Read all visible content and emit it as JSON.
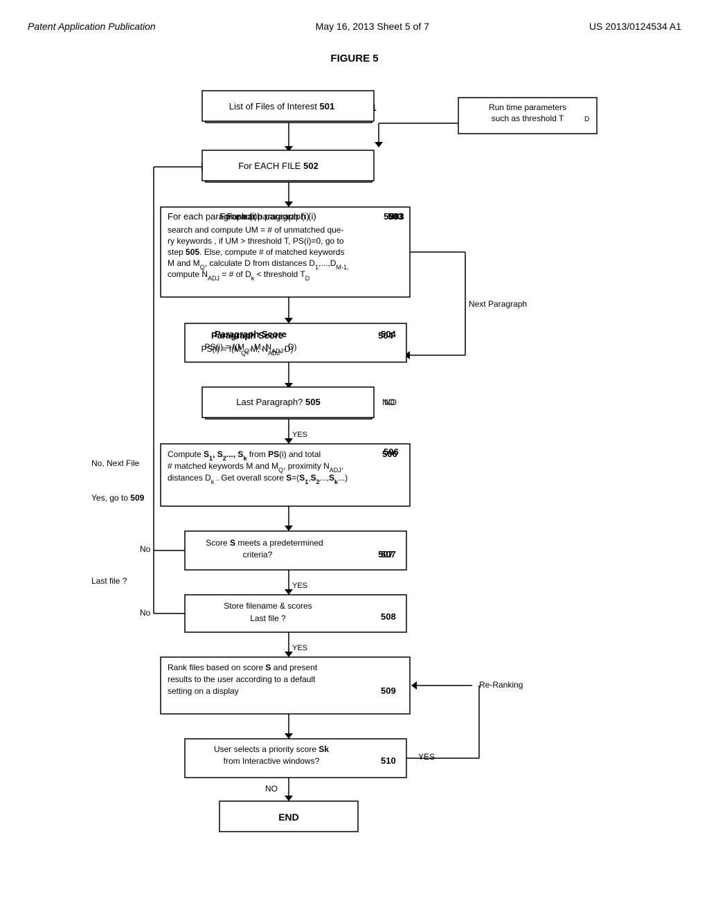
{
  "header": {
    "left": "Patent Application Publication",
    "center": "May 16, 2013   Sheet 5 of 7",
    "right": "US 2013/0124534 A1"
  },
  "figure": {
    "title": "FIGURE 5"
  },
  "boxes": {
    "box501": {
      "label": "List of Files of Interest",
      "num": "501"
    },
    "box502": {
      "label": "For EACH FILE",
      "num": "502"
    },
    "box_runtime": {
      "text": "Run time parameters\nsuch as threshold T",
      "subscript": "D"
    },
    "box503": {
      "label": "For each paragraph (i)",
      "num": "503",
      "detail": "search and compute UM = # of unmatched query keywords , if UM > threshold T, PS(i)=0, go to step 505. Else, compute # of matched keywords M and Mᴊ, calculate D from distances D₁,...,Dₘ₋₁, compute Nₐₑⰼ = # of Dₖ < threshold Tᴅ"
    },
    "box504": {
      "label": "Paragraph Score",
      "num": "504",
      "formula": "PS(i) = f(Mᴊ, M, Nₐₑⰼ, D)"
    },
    "box505": {
      "label": "Last Paragraph?",
      "num": "505"
    },
    "box506": {
      "num": "506",
      "text": "Compute S₁, S₂..., Sₖ from PS(i)  and  total # matched keywords M and Mᴊ, proximity Nₐₑⰼ, distances Dₖ . Get overall score S=(S₁,S₂...,Sₖ...)"
    },
    "box507": {
      "num": "507",
      "text": "Score S meets a predetermined criteria?"
    },
    "box508": {
      "num": "508",
      "text": "Store filename & scores\nLast file ?"
    },
    "box509": {
      "num": "509",
      "text": "Rank files based on score S and present results to the user according to a default setting  on a display"
    },
    "box510": {
      "num": "510",
      "text": "User selects  a  priority score Sk from Interactive windows?"
    },
    "box_end": {
      "label": "END"
    }
  },
  "labels": {
    "no_next_file": "No, Next File",
    "last_file": "Last file ?",
    "yes_go_509": "Yes, go to 509",
    "next_paragraph": "Next Paragraph",
    "no": "No",
    "yes": "YES",
    "no2": "No",
    "yes2": "YES",
    "reranking": "Re-Ranking",
    "yes3": "YES",
    "no3": "NO"
  }
}
